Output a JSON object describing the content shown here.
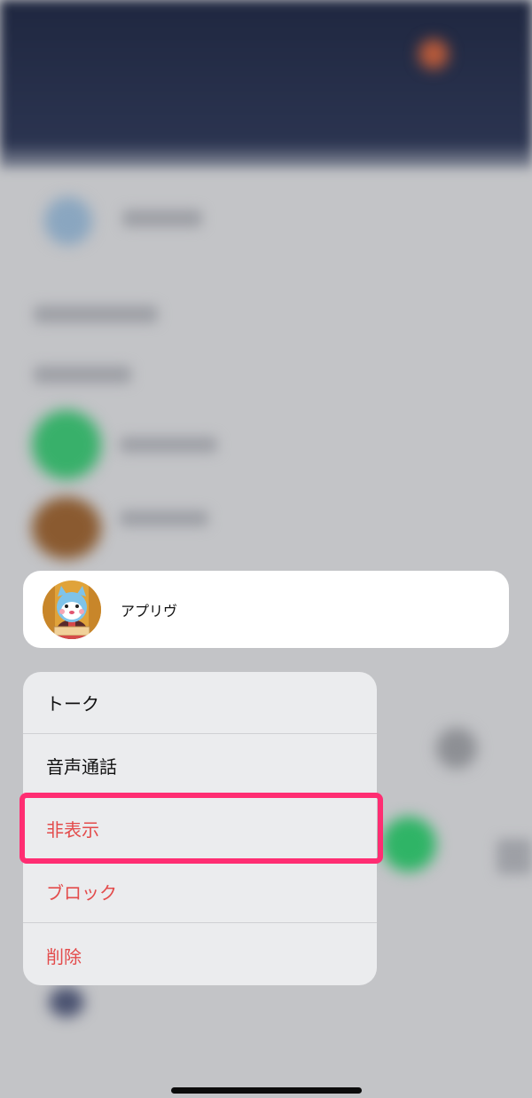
{
  "profile": {
    "name": "アプリヴ"
  },
  "menu": {
    "items": [
      {
        "label": "トーク",
        "style": "normal"
      },
      {
        "label": "音声通話",
        "style": "normal"
      },
      {
        "label": "非表示",
        "style": "destructive"
      },
      {
        "label": "ブロック",
        "style": "destructive"
      },
      {
        "label": "削除",
        "style": "destructive"
      }
    ]
  },
  "colors": {
    "destructive": "#e34b4b",
    "highlight": "#ff2d72",
    "header_bg": "#1f2740"
  }
}
